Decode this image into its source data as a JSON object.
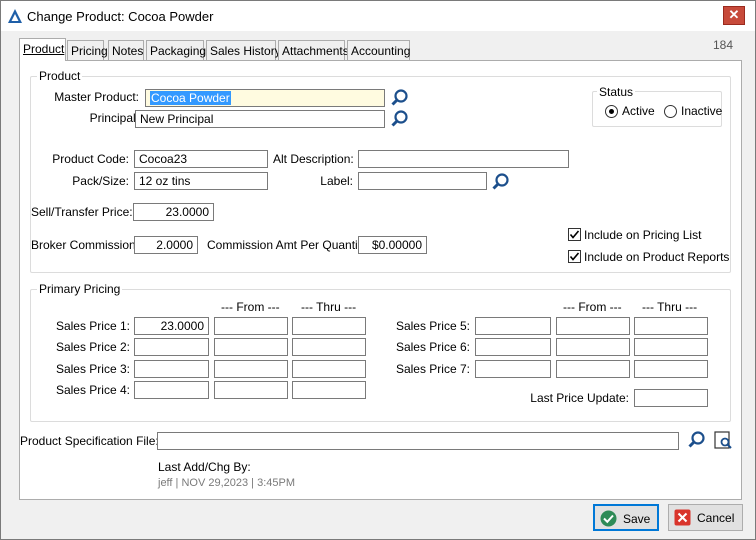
{
  "window": {
    "title": "Change Product: Cocoa Powder",
    "close_glyph": "✕"
  },
  "tabs": [
    {
      "label": "Product",
      "active": true
    },
    {
      "label": "Pricing"
    },
    {
      "label": "Notes"
    },
    {
      "label": "Packaging"
    },
    {
      "label": "Sales History"
    },
    {
      "label": "Attachments"
    },
    {
      "label": "Accounting"
    }
  ],
  "page_number": "184",
  "product": {
    "group_label": "Product",
    "master_product_label": "Master Product:",
    "master_product_value": "Cocoa Powder",
    "principal_label": "Principal:",
    "principal_value": "New Principal",
    "product_code_label": "Product Code:",
    "product_code_value": "Cocoa23",
    "pack_size_label": "Pack/Size:",
    "pack_size_value": "12 oz tins",
    "alt_description_label": "Alt Description:",
    "alt_description_value": "",
    "label_label": "Label:",
    "label_value": "",
    "sell_transfer_label": "Sell/Transfer Price:",
    "sell_transfer_value": "23.0000",
    "broker_commission_label": "Broker Commission:",
    "broker_commission_value": "2.0000",
    "commission_amt_label": "Commission Amt Per Quantity:",
    "commission_amt_value": "$0.00000",
    "include_pricing_label": "Include on Pricing List",
    "include_pricing_checked": true,
    "include_reports_label": "Include on Product Reports",
    "include_reports_checked": true
  },
  "status": {
    "group_label": "Status",
    "active_label": "Active",
    "inactive_label": "Inactive",
    "selected": "Active"
  },
  "primary_pricing": {
    "group_label": "Primary Pricing",
    "from_header": "--- From ---",
    "thru_header": "--- Thru ---",
    "left_rows": [
      {
        "label": "Sales Price 1:",
        "price": "23.0000",
        "from": "",
        "thru": ""
      },
      {
        "label": "Sales Price 2:",
        "price": "",
        "from": "",
        "thru": ""
      },
      {
        "label": "Sales Price 3:",
        "price": "",
        "from": "",
        "thru": ""
      },
      {
        "label": "Sales Price 4:",
        "price": "",
        "from": "",
        "thru": ""
      }
    ],
    "right_rows": [
      {
        "label": "Sales Price 5:",
        "price": "",
        "from": "",
        "thru": ""
      },
      {
        "label": "Sales Price 6:",
        "price": "",
        "from": "",
        "thru": ""
      },
      {
        "label": "Sales Price 7:",
        "price": "",
        "from": "",
        "thru": ""
      }
    ],
    "last_price_update_label": "Last Price Update:",
    "last_price_update_value": ""
  },
  "spec_file": {
    "label": "Product Specification File:",
    "value": ""
  },
  "last_change": {
    "label": "Last Add/Chg By:",
    "value": "jeff | NOV 29,2023 |  3:45PM"
  },
  "buttons": {
    "save_label": "Save",
    "cancel_label": "Cancel"
  },
  "colors": {
    "accent": "#0078d7",
    "selection": "#3399ff",
    "cancel_icon": "#d9342b",
    "save_icon": "#2e8b57"
  }
}
